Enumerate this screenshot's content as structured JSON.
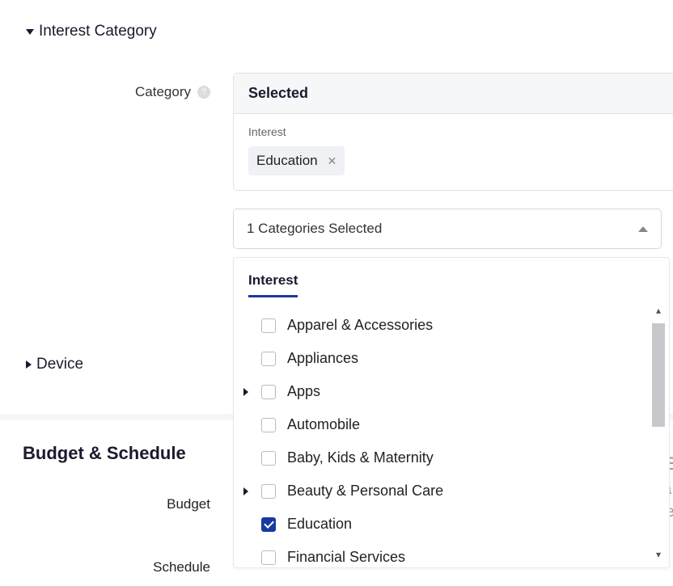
{
  "sections": {
    "interest_category": "Interest Category",
    "device": "Device",
    "budget_schedule": "Budget & Schedule"
  },
  "category": {
    "label": "Category",
    "selected_header": "Selected",
    "selected_label": "Interest",
    "chip": "Education",
    "summary": "1 Categories Selected"
  },
  "dropdown": {
    "tab": "Interest",
    "items": [
      {
        "label": "Apparel & Accessories",
        "checked": false,
        "expandable": false
      },
      {
        "label": "Appliances",
        "checked": false,
        "expandable": false
      },
      {
        "label": "Apps",
        "checked": false,
        "expandable": true
      },
      {
        "label": "Automobile",
        "checked": false,
        "expandable": false
      },
      {
        "label": "Baby, Kids & Maternity",
        "checked": false,
        "expandable": false
      },
      {
        "label": "Beauty & Personal Care",
        "checked": false,
        "expandable": true
      },
      {
        "label": "Education",
        "checked": true,
        "expandable": false
      },
      {
        "label": "Financial Services",
        "checked": false,
        "expandable": false
      }
    ]
  },
  "budget": {
    "budget_label": "Budget",
    "schedule_label": "Schedule"
  },
  "watermark": {
    "line1": "Актив",
    "line2": "Чтобы а",
    "line3": "\"Параме"
  }
}
